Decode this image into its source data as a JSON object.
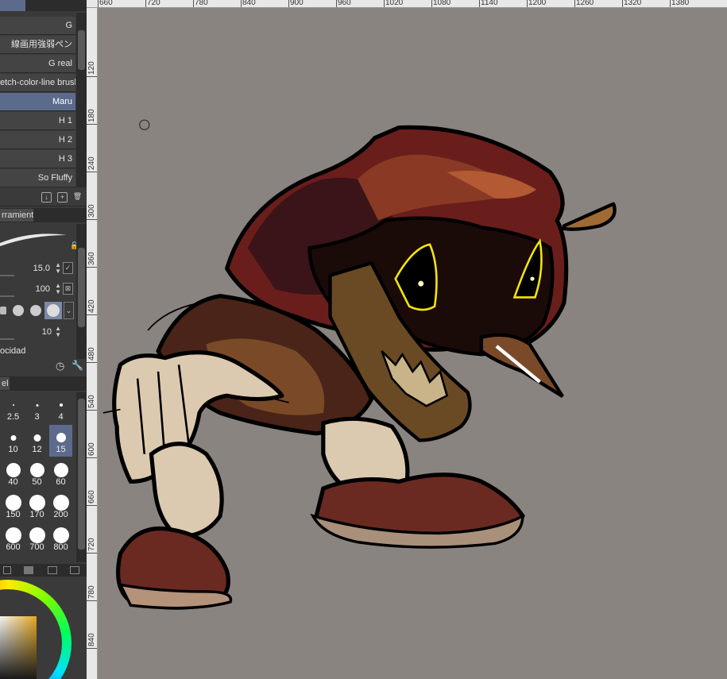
{
  "sub_tools": [
    "G",
    "線画用強弱ペン",
    "G real",
    "etch-color-line brush",
    "Maru",
    "H 1",
    "H 2",
    "H 3",
    "So Fluffy"
  ],
  "selected_sub_tool": "Maru",
  "tool_property": {
    "tab_label": "rramienta",
    "brush_size": "15.0",
    "opacity": "100",
    "stabilization": "10",
    "dynamics_label": "ocidad"
  },
  "brush_size_palette": {
    "tab_label": "el",
    "sizes": [
      "2.5",
      "3",
      "4",
      "10",
      "12",
      "15",
      "40",
      "50",
      "60",
      "150",
      "170",
      "200",
      "600",
      "700",
      "800"
    ],
    "selected": "15"
  },
  "ruler": {
    "horizontal": [
      "660",
      "720",
      "780",
      "840",
      "900",
      "960",
      "1020",
      "1080",
      "1140",
      "1200",
      "1260",
      "1320",
      "1380"
    ],
    "vertical": [
      "120",
      "180",
      "240",
      "300",
      "360",
      "420",
      "480",
      "540",
      "600",
      "660",
      "720",
      "780",
      "840"
    ]
  },
  "colors": {
    "panel_bg": "#3a3a3a",
    "selection": "#5c6a8c",
    "canvas_bg": "#8a8480",
    "eye_glow": "#f2e40b"
  },
  "icons": [
    "save-icon",
    "copy-icon",
    "trash-icon",
    "lock-icon",
    "reset-icon",
    "wrench-icon",
    "checkbox-icon"
  ]
}
